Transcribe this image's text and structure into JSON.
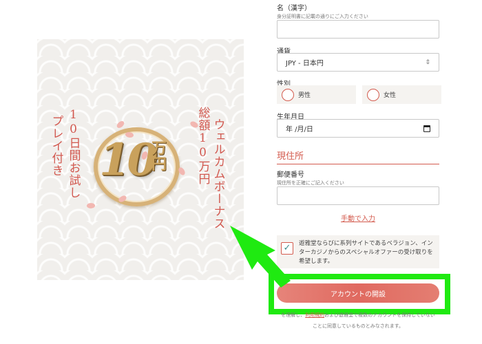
{
  "banner": {
    "total_text": "総額10万円",
    "welcome_text": "ウェルカムボーナス",
    "trial_text": "10日間お試し",
    "play_text": "プレイ付き",
    "coin_number": "10",
    "coin_unit": "万円"
  },
  "form": {
    "name_kanji": {
      "label": "名（漢字）",
      "hint": "身分証明書に記載の通りにご入力ください",
      "value": ""
    },
    "currency": {
      "label": "通貨",
      "value": "JPY - 日本円"
    },
    "gender": {
      "label": "性別",
      "options": [
        "男性",
        "女性"
      ]
    },
    "birthdate": {
      "label": "生年月日",
      "value": "年 /月/日"
    },
    "address_section": "現住所",
    "postal_code": {
      "label": "郵便番号",
      "hint": "現住所を正確にご記入ください",
      "value": ""
    },
    "manual_entry_link": "手動で入力",
    "consent": {
      "checked": true,
      "text": "遊雅堂ならびに系列サイトであるベラジョン、インターカジノからのスペシャルオファーの受け取りを希望します。"
    },
    "submit_label": "アカウントの開設",
    "terms": {
      "line1_prefix": "を理解し、",
      "line1_link": "利用規約",
      "line1_suffix": "および遊雅堂で複数のアカウントを保持していない",
      "line2": "ことに同意しているものとみなされます。"
    }
  },
  "colors": {
    "accent": "#d35a4d",
    "highlight": "#1fea11",
    "field_bg": "#f5f3f0"
  }
}
